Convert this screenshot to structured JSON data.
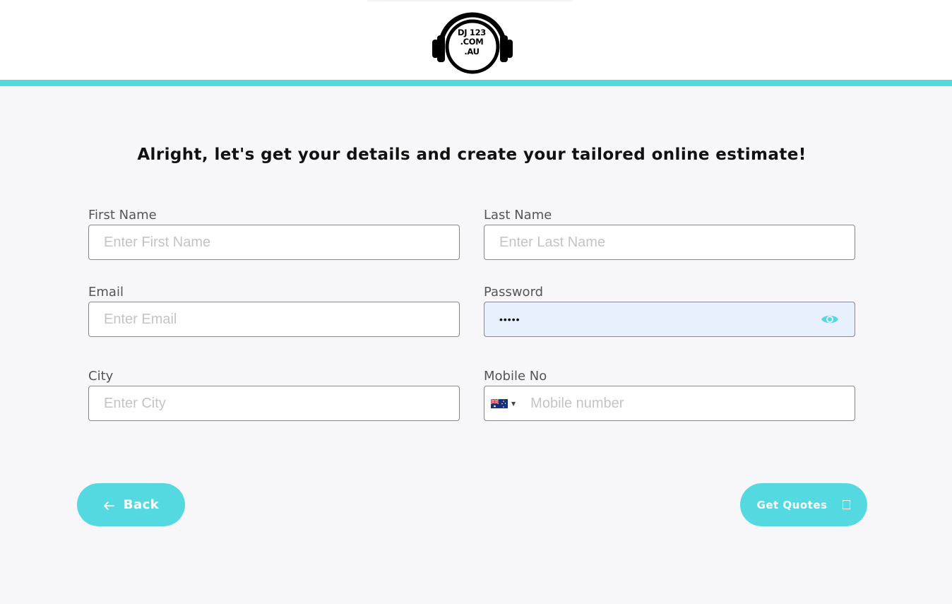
{
  "logo": {
    "lines": [
      "DJ 123",
      ".COM",
      ".AU"
    ],
    "icon": "headphones-logo"
  },
  "heading": "Alright, let's get your details and create your tailored online estimate!",
  "form": {
    "first_name": {
      "label": "First Name",
      "placeholder": "Enter First Name",
      "value": ""
    },
    "last_name": {
      "label": "Last Name",
      "placeholder": "Enter Last Name",
      "value": ""
    },
    "email": {
      "label": "Email",
      "placeholder": "Enter Email",
      "value": ""
    },
    "password": {
      "label": "Password",
      "value_masked": "•••••",
      "toggle_icon": "eye-icon"
    },
    "city": {
      "label": "City",
      "placeholder": "Enter City",
      "value": ""
    },
    "mobile": {
      "label": "Mobile No",
      "placeholder": "Mobile number",
      "country": "Australia",
      "country_icon": "australia-flag-icon"
    }
  },
  "buttons": {
    "back": {
      "label": "Back",
      "icon": "arrow-left-icon"
    },
    "get_quotes": {
      "label": "Get Quotes",
      "icon": "box-icon"
    }
  },
  "colors": {
    "accent": "#55d9e0",
    "autofill": "#e8f0fe",
    "background": "#f7f7f9"
  }
}
